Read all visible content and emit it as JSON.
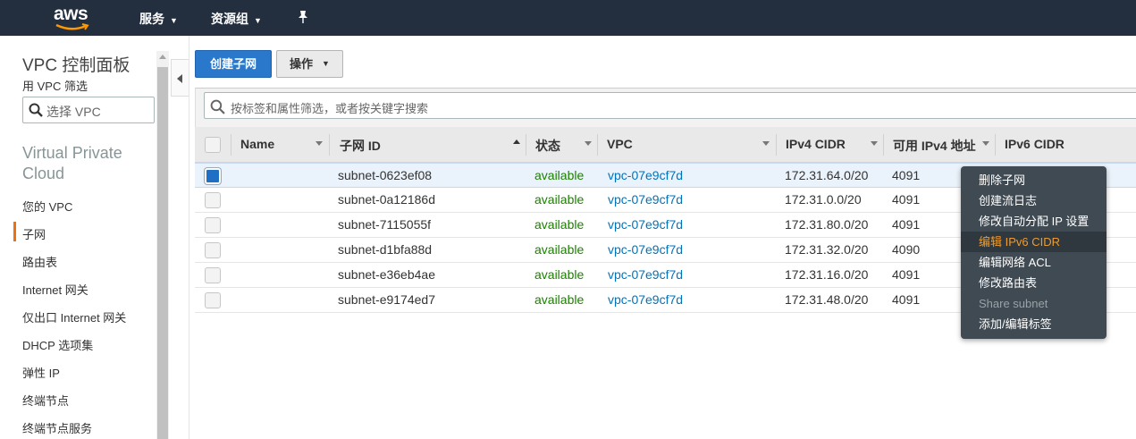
{
  "topnav": {
    "logo_text": "aws",
    "services": "服务",
    "resource_groups": "资源组"
  },
  "sidebar": {
    "title": "VPC 控制面板",
    "filter_label": "用 VPC 筛选",
    "filter_placeholder": "选择 VPC",
    "section": "Virtual Private Cloud",
    "items": [
      {
        "label": "您的 VPC"
      },
      {
        "label": "子网",
        "active": true
      },
      {
        "label": "路由表"
      },
      {
        "label": "Internet 网关"
      },
      {
        "label": "仅出口 Internet 网关"
      },
      {
        "label": "DHCP 选项集"
      },
      {
        "label": "弹性 IP"
      },
      {
        "label": "终端节点"
      },
      {
        "label": "终端节点服务"
      }
    ]
  },
  "toolbar": {
    "create_label": "创建子网",
    "actions_label": "操作"
  },
  "search": {
    "placeholder": "按标签和属性筛选，或者按关键字搜索"
  },
  "table": {
    "columns": [
      "Name",
      "子网 ID",
      "状态",
      "VPC",
      "IPv4 CIDR",
      "可用 IPv4 地址",
      "IPv6 CIDR"
    ],
    "rows": [
      {
        "name": "",
        "subnet_id": "subnet-0623ef08",
        "status": "available",
        "vpc": "vpc-07e9cf7d",
        "ipv4": "172.31.64.0/20",
        "available": "4091",
        "selected": true
      },
      {
        "name": "",
        "subnet_id": "subnet-0a12186d",
        "status": "available",
        "vpc": "vpc-07e9cf7d",
        "ipv4": "172.31.0.0/20",
        "available": "4091"
      },
      {
        "name": "",
        "subnet_id": "subnet-7115055f",
        "status": "available",
        "vpc": "vpc-07e9cf7d",
        "ipv4": "172.31.80.0/20",
        "available": "4091"
      },
      {
        "name": "",
        "subnet_id": "subnet-d1bfa88d",
        "status": "available",
        "vpc": "vpc-07e9cf7d",
        "ipv4": "172.31.32.0/20",
        "available": "4090"
      },
      {
        "name": "",
        "subnet_id": "subnet-e36eb4ae",
        "status": "available",
        "vpc": "vpc-07e9cf7d",
        "ipv4": "172.31.16.0/20",
        "available": "4091"
      },
      {
        "name": "",
        "subnet_id": "subnet-e9174ed7",
        "status": "available",
        "vpc": "vpc-07e9cf7d",
        "ipv4": "172.31.48.0/20",
        "available": "4091"
      }
    ]
  },
  "context_menu": {
    "items": [
      {
        "label": "删除子网"
      },
      {
        "label": "创建流日志"
      },
      {
        "label": "修改自动分配 IP 设置"
      },
      {
        "label": "编辑 IPv6 CIDR",
        "highlighted": true
      },
      {
        "label": "编辑网络 ACL"
      },
      {
        "label": "修改路由表"
      },
      {
        "label": "Share subnet",
        "disabled": true
      },
      {
        "label": "添加/编辑标签"
      }
    ]
  },
  "colors": {
    "nav_bg": "#232f3e",
    "primary": "#2a78cb",
    "accent": "#ec7211",
    "available": "#1d8102",
    "link": "#0073bb",
    "menu_bg": "#404a52"
  }
}
